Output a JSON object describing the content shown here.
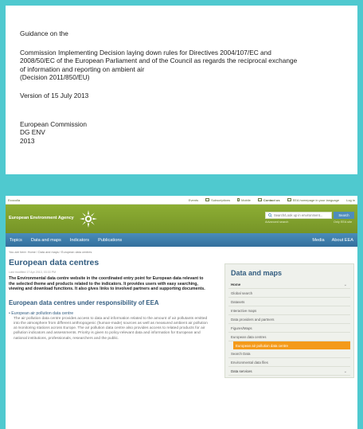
{
  "document": {
    "line1": "Guidance on the",
    "title_lines": [
      "Commission Implementing Decision laying down rules for Directives 2004/107/EC and",
      "2008/50/EC of the European Parliament and of the Council as regards the reciprocal exchange",
      "of information and reporting on ambient air",
      "(Decision 2011/850/EU)"
    ],
    "version": "Version of 15 July 2013",
    "org_lines": [
      "European Commission",
      "DG ENV",
      "2013"
    ]
  },
  "site": {
    "utility": {
      "left": "Ecocolla",
      "items": [
        "Events",
        "Subscriptions",
        "Mobile",
        "Contact us",
        "EEA homepage in your language",
        "Log in"
      ]
    },
    "brand": "European Environment Agency",
    "search": {
      "placeholder": "Search/Look up in environment...",
      "button": "Search",
      "advanced": "Advanced search",
      "only_eea": "Only EEA site"
    },
    "nav": {
      "items": [
        "Topics",
        "Data and maps",
        "Indicators",
        "Publications"
      ],
      "right": [
        "Media",
        "About EEA"
      ]
    },
    "breadcrumb": "You are here: Home / Data and maps / European data centres",
    "page_title": "European data centres",
    "meta": "Last modified 17 Apr 2013, 03:33 PM",
    "intro": "The Environmental data centre website in the coordinated entry point for European data relevant to the selected theme and products related to the indicators. It provides users with easy searching, viewing and download functions. It also gives links to involved partners and supporting documents.",
    "section_heading": "European data centres under responsibility of EEA",
    "bullet": {
      "title": "• European air pollution data centre",
      "text": "The air pollution data centre provides access to data and information related to the amount of air pollutants emitted into the atmosphere from different anthropogenic (human-made) sources as well as measured ambient air pollution at monitoring stations across Europe. The air pollution data centre also provides access to related products for air pollution indicators and assessments. Priority is given to policy-relevant data and information for European and national institutions, professionals, researchers and the public."
    },
    "sidebar": {
      "title": "Data and maps",
      "items": [
        {
          "label": "Home",
          "header": true,
          "chev": true
        },
        {
          "label": "Global search"
        },
        {
          "label": "Datasets"
        },
        {
          "label": "Interactive maps"
        },
        {
          "label": "Data providers and partners"
        },
        {
          "label": "Figures/Maps"
        },
        {
          "label": "European data centres"
        },
        {
          "label": "European air pollution data centre",
          "active": true
        },
        {
          "label": "Search Data"
        },
        {
          "label": "Environmental data files"
        },
        {
          "label": "Data services",
          "chev": true
        }
      ]
    }
  }
}
